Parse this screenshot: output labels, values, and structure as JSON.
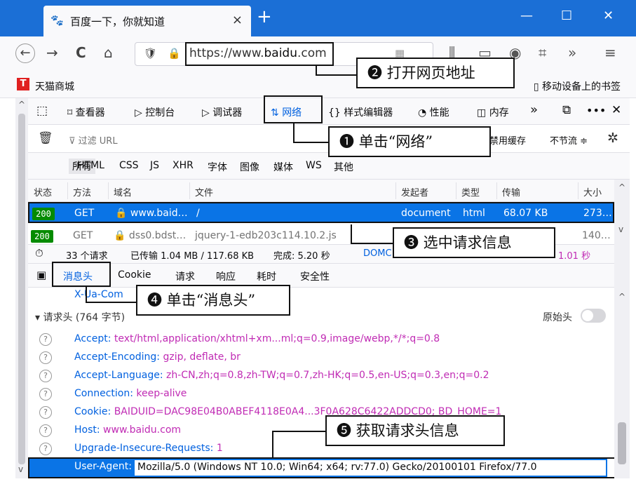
{
  "browser": {
    "tab_title": "百度一下，你就知道",
    "tab_close": "×",
    "new_tab": "+",
    "window_controls": {
      "minimize": "—",
      "maximize": "☐",
      "close": "✕"
    },
    "url_prefix": "https://www.",
    "url_domain": "baidu",
    "url_suffix": ".com",
    "nav_icons": [
      "back-icon",
      "forward-icon",
      "reload-icon",
      "home-icon"
    ]
  },
  "bookmarks": {
    "tmall_logo": "T",
    "tmall_label": "天猫商城",
    "mobile_label": "移动设备上的书签"
  },
  "devtools": {
    "tabs": {
      "inspector": "查看器",
      "console": "控制台",
      "debugger": "调试器",
      "network": "网络",
      "style_editor": "样式编辑器",
      "performance": "性能",
      "memory": "内存"
    },
    "filter_placeholder": "过滤 URL",
    "disable_cache": "禁用缓存",
    "throttle": "不节流 ≑",
    "type_filters": [
      "所有",
      "HTML",
      "CSS",
      "JS",
      "XHR",
      "字体",
      "图像",
      "媒体",
      "WS",
      "其他"
    ],
    "columns": [
      "状态",
      "方法",
      "域名",
      "文件",
      "发起者",
      "类型",
      "传输",
      "大小"
    ],
    "requests": [
      {
        "status": "200",
        "method": "GET",
        "domain": "www.baid…",
        "file": "/",
        "initiator": "document",
        "type": "html",
        "transferred": "68.07 KB",
        "size": "273…"
      },
      {
        "status": "200",
        "method": "GET",
        "domain": "dss0.bdst…",
        "file": "jquery-1-edb203c114.10.2.js",
        "initiator": "",
        "type": "",
        "transferred": "",
        "size": "140…"
      }
    ],
    "summary": {
      "requests": "33 个请求",
      "transferred": "已传输 1.04 MB / 117.68 KB",
      "finish": "完成: 5.20 秒",
      "domcontent": "DOMC",
      "load": "1.01 秒"
    },
    "detail_tabs": [
      "消息头",
      "Cookie",
      "请求",
      "响应",
      "耗时",
      "安全性"
    ],
    "partial_header": "X-Ua-Com",
    "request_headers_title": "请求头 (764 字节)",
    "raw_headers": "原始头",
    "headers": [
      {
        "key": "Accept:",
        "value": "text/html,application/xhtml+xm...ml;q=0.9,image/webp,*/*;q=0.8"
      },
      {
        "key": "Accept-Encoding:",
        "value": "gzip, deflate, br"
      },
      {
        "key": "Accept-Language:",
        "value": "zh-CN,zh;q=0.8,zh-TW;q=0.7,zh-HK;q=0.5,en-US;q=0.3,en;q=0.2"
      },
      {
        "key": "Connection:",
        "value": "keep-alive"
      },
      {
        "key": "Cookie:",
        "value": "BAIDUID=DAC98E04B0ABEF4118E0A4...3F0A628C6422ADDCD0; BD_HOME=1"
      },
      {
        "key": "Host:",
        "value": "www.baidu.com"
      },
      {
        "key": "Upgrade-Insecure-Requests:",
        "value": "1"
      }
    ],
    "user_agent_key": "User-Agent:",
    "user_agent_value": "Mozilla/5.0 (Windows NT 10.0; Win64; x64; rv:77.0) Gecko/20100101 Firefox/77.0"
  },
  "callouts": {
    "step1": "❶ 单击“网络”",
    "step2": "❷ 打开网页地址",
    "step3": "❸ 选中请求信息",
    "step4": "❹ 单击“消息头”",
    "step5": "❺ 获取请求头信息"
  },
  "colors": {
    "titlebar": "#1b6fd6",
    "selection": "#0a74e6",
    "accent": "#0060df",
    "status_ok": "#058b00",
    "header_value": "#c02bb4"
  }
}
